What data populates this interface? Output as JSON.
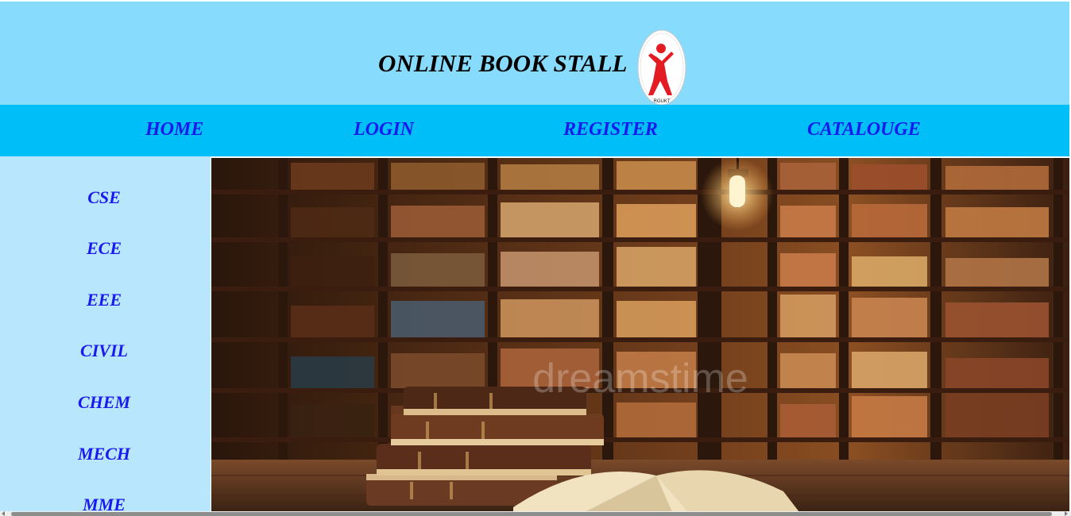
{
  "header": {
    "title": "ONLINE BOOK STALL",
    "logo_label": "RGUKT",
    "logo_icon": "rgukt-logo-icon"
  },
  "nav": {
    "items": [
      {
        "label": "HOME"
      },
      {
        "label": "LOGIN"
      },
      {
        "label": "REGISTER"
      },
      {
        "label": "CATALOUGE"
      }
    ]
  },
  "sidebar": {
    "items": [
      {
        "label": "CSE"
      },
      {
        "label": "ECE"
      },
      {
        "label": "EEE"
      },
      {
        "label": "CIVIL"
      },
      {
        "label": "CHEM"
      },
      {
        "label": "MECH"
      },
      {
        "label": "MME"
      }
    ]
  },
  "hero": {
    "watermark": "dreamstime"
  },
  "colors": {
    "header_bg": "#87dbfd",
    "nav_bg": "#00bef8",
    "sidebar_bg": "#b8e6fd",
    "link": "#1a1aee",
    "logo_red": "#e31b23"
  }
}
